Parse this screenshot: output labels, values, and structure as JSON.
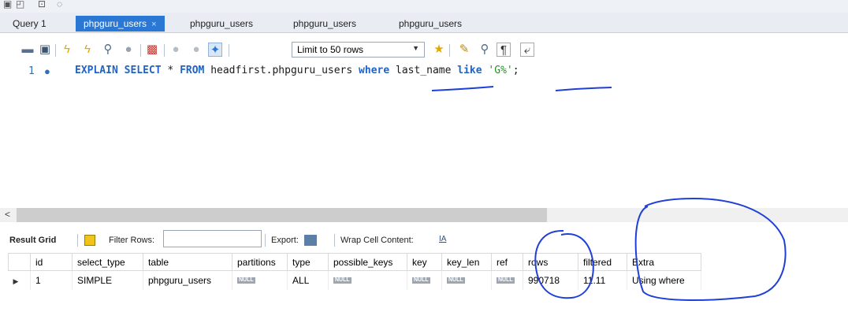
{
  "tabs": [
    {
      "label": "Query 1",
      "active": false
    },
    {
      "label": "phpguru_users",
      "active": true,
      "close": "×"
    },
    {
      "label": "phpguru_users",
      "active": false
    },
    {
      "label": "phpguru_users",
      "active": false
    },
    {
      "label": "phpguru_users",
      "active": false
    }
  ],
  "toolbar": {
    "limit_label": "Limit to 50 rows",
    "icons": [
      "open-folder-icon",
      "save-icon",
      "execute-icon",
      "execute-current-icon",
      "explain-icon",
      "stop-icon",
      "toggle-output-icon",
      "commit-icon",
      "rollback-icon",
      "autocommit-icon",
      "favorite-icon",
      "beautify-icon",
      "find-icon",
      "invisible-chars-icon",
      "wrap-icon"
    ]
  },
  "editor": {
    "line_number": "1",
    "marker": "●",
    "sql": {
      "p1": "EXPLAIN SELECT",
      "p2": " * ",
      "p3": "FROM",
      "p4": " headfirst.phpguru_users ",
      "p5": "where",
      "p6": " last_name ",
      "p7": "like",
      "p8": " ",
      "p9": "'G%'",
      "p10": ";"
    }
  },
  "result_toolbar": {
    "result_grid": "Result Grid",
    "filter_rows": "Filter Rows:",
    "filter_value": "",
    "export": "Export:",
    "wrap": "Wrap Cell Content:",
    "wrap_icon_text": "IA"
  },
  "grid": {
    "columns": [
      "id",
      "select_type",
      "table",
      "partitions",
      "type",
      "possible_keys",
      "key",
      "key_len",
      "ref",
      "rows",
      "filtered",
      "Extra"
    ],
    "row": {
      "id": "1",
      "select_type": "SIMPLE",
      "table": "phpguru_users",
      "partitions": "NULL",
      "type": "ALL",
      "possible_keys": "NULL",
      "key": "NULL",
      "key_len": "NULL",
      "ref": "NULL",
      "rows": "990718",
      "filtered": "11.11",
      "Extra": "Using where"
    },
    "row_marker": "▶"
  },
  "scrollbar": {
    "left_arrow": "<"
  },
  "colors": {
    "accent": "#2a78d4",
    "annotation": "#1f3fd6",
    "keyword": "#1f63c6",
    "string": "#2a8d2a"
  }
}
